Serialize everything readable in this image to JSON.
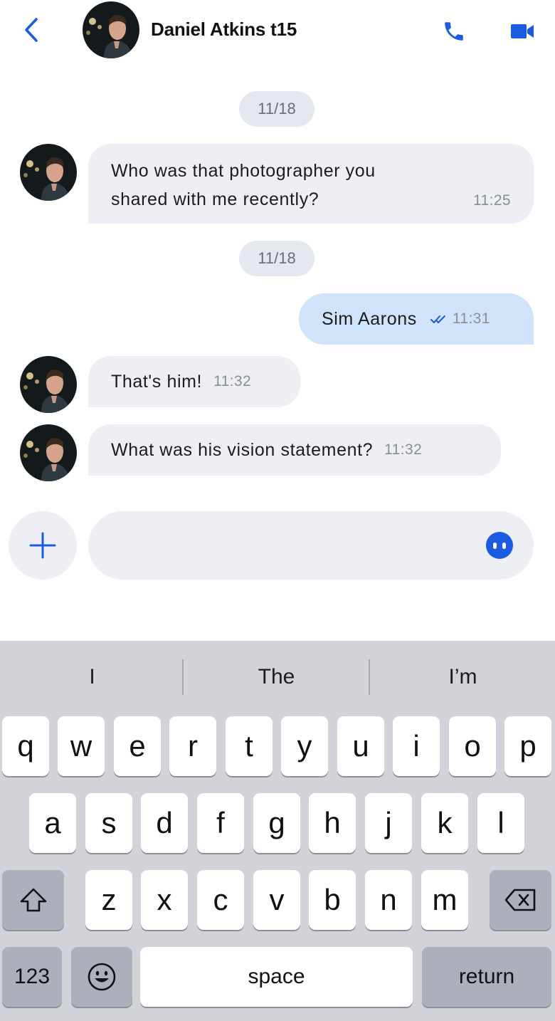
{
  "header": {
    "contact_name": "Daniel Atkins t15",
    "back_icon": "chevron-left-icon",
    "call_icon": "phone-icon",
    "video_icon": "video-camera-icon",
    "accent_color": "#1a5be0"
  },
  "messages": [
    {
      "type": "date",
      "text": "11/18"
    },
    {
      "type": "incoming",
      "lines": [
        "Who was that photographer you",
        "shared with me recently?"
      ],
      "time": "11:25"
    },
    {
      "type": "date",
      "text": "11/18"
    },
    {
      "type": "outgoing",
      "text": "Sim Aarons",
      "time": "11:31",
      "status_icon": "double-check-icon"
    },
    {
      "type": "incoming",
      "text": "That's him!",
      "time": "11:32"
    },
    {
      "type": "incoming",
      "text": "What was his vision statement?",
      "time": "11:32"
    }
  ],
  "composer": {
    "value": "",
    "placeholder": "",
    "add_icon": "plus-icon",
    "emoji_icon": "emoji-icon"
  },
  "keyboard": {
    "suggestions": [
      "I",
      "The",
      "I’m"
    ],
    "row1": [
      "q",
      "w",
      "e",
      "r",
      "t",
      "y",
      "u",
      "i",
      "o",
      "p"
    ],
    "row2": [
      "a",
      "s",
      "d",
      "f",
      "g",
      "h",
      "j",
      "k",
      "l"
    ],
    "row3": [
      "z",
      "x",
      "c",
      "v",
      "b",
      "n",
      "m"
    ],
    "numbers_label": "123",
    "space_label": "space",
    "return_label": "return"
  }
}
